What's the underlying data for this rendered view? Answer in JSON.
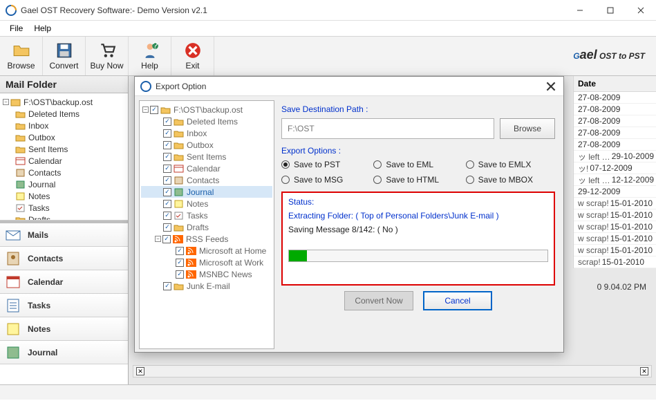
{
  "title": "Gael OST Recovery Software:- Demo Version v2.1",
  "menu": {
    "file": "File",
    "help": "Help"
  },
  "toolbar": {
    "browse": "Browse",
    "convert": "Convert",
    "buynow": "Buy Now",
    "help": "Help",
    "exit": "Exit"
  },
  "brand": {
    "prefix": "G",
    "mid": "ael",
    "rest": " OST to PST"
  },
  "leftHead": "Mail Folder",
  "tree": {
    "root": "F:\\OST\\backup.ost",
    "items": [
      "Deleted Items",
      "Inbox",
      "Outbox",
      "Sent Items",
      "Calendar",
      "Contacts",
      "Journal",
      "Notes",
      "Tasks",
      "Drafts",
      "RSS Feeds"
    ]
  },
  "nav": [
    "Mails",
    "Contacts",
    "Calendar",
    "Tasks",
    "Notes",
    "Journal"
  ],
  "dates": {
    "header": "Date",
    "rows": [
      {
        "pre": "",
        "d": "27-08-2009"
      },
      {
        "pre": "",
        "d": "27-08-2009"
      },
      {
        "pre": "",
        "d": "27-08-2009"
      },
      {
        "pre": "",
        "d": "27-08-2009"
      },
      {
        "pre": "",
        "d": "27-08-2009"
      },
      {
        "pre": "ッ left …",
        "d": "29-10-2009"
      },
      {
        "pre": "ッ!",
        "d": "07-12-2009"
      },
      {
        "pre": "ッ left …",
        "d": "12-12-2009"
      },
      {
        "pre": "",
        "d": "29-12-2009"
      },
      {
        "pre": "w scrap!",
        "d": "15-01-2010"
      },
      {
        "pre": "w scrap!",
        "d": "15-01-2010"
      },
      {
        "pre": "w scrap!",
        "d": "15-01-2010"
      },
      {
        "pre": "w scrap!",
        "d": "15-01-2010"
      },
      {
        "pre": "w scrap!",
        "d": "15-01-2010"
      },
      {
        "pre": " scrap!",
        "d": "15-01-2010"
      }
    ]
  },
  "timestamp": "0 9.04.02 PM",
  "dialog": {
    "title": "Export Option",
    "tree": {
      "root": "F:\\OST\\backup.ost",
      "l1": [
        "Deleted Items",
        "Inbox",
        "Outbox",
        "Sent Items",
        "Calendar",
        "Contacts",
        "Journal",
        "Notes",
        "Tasks",
        "Drafts",
        "RSS Feeds",
        "Junk E-mail"
      ],
      "rss": [
        "Microsoft at Home",
        "Microsoft at Work",
        "MSNBC News"
      ]
    },
    "saveLabel": "Save Destination Path :",
    "path": "F:\\OST",
    "browse": "Browse",
    "optLabel": "Export Options :",
    "opts": [
      "Save to PST",
      "Save to EML",
      "Save to EMLX",
      "Save to MSG",
      "Save to HTML",
      "Save to MBOX"
    ],
    "selected": 0,
    "status": {
      "label": "Status:",
      "folder": "Extracting Folder: ( Top of Personal Folders\\Junk E-mail )",
      "msg": "Saving Message 8/142: ( No )"
    },
    "convert": "Convert Now",
    "cancel": "Cancel"
  }
}
